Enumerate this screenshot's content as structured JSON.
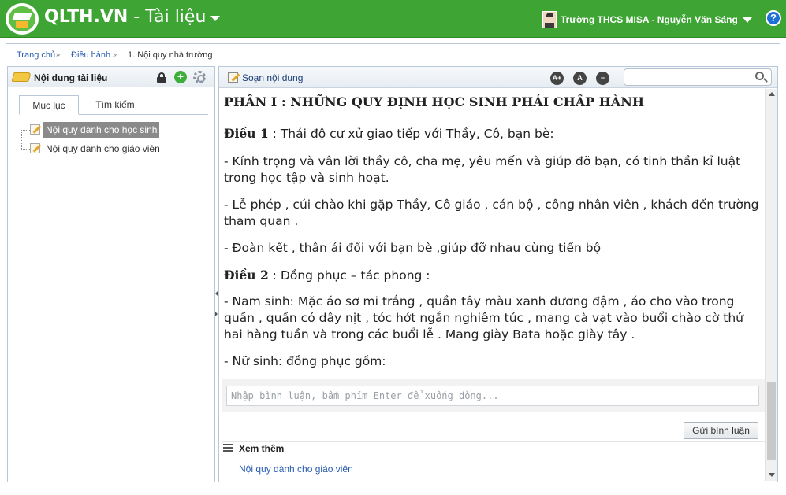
{
  "header": {
    "brand_name": "QLTH.VN",
    "brand_separator": " - ",
    "brand_module": "Tài liệu",
    "user_label": "Trường THCS MISA - Nguyễn Văn Sáng",
    "help_symbol": "?",
    "brand_color": "#3ea535"
  },
  "breadcrumb": {
    "items": [
      "Trang chủ",
      "Điều hành",
      "1. Nội quy nhà trường"
    ],
    "separator": "»"
  },
  "left_panel": {
    "title": "Nội dung tài liệu",
    "add_symbol": "+",
    "tabs": [
      "Mục lục",
      "Tìm kiếm"
    ],
    "tree_items": [
      {
        "label": "Nội quy dành cho học sinh",
        "selected": true
      },
      {
        "label": "Nội quy dành cho giáo viên",
        "selected": false
      }
    ]
  },
  "right_panel": {
    "title": "Soạn nội dung",
    "font_buttons": [
      "A+",
      "A",
      "−"
    ],
    "search_placeholder": "",
    "document": {
      "heading": "PHẦN I : NHỮNG QUY ĐỊNH HỌC SINH PHẢI CHẤP HÀNH",
      "paragraphs": [
        {
          "bold": "Điều 1",
          "text": " : Thái độ cư xử giao tiếp với Thầy, Cô, bạn bè:"
        },
        {
          "bold": "",
          "text": "- Kính trọng và vân lời thầy cô, cha mẹ, yêu mến và giúp đỡ bạn, có tinh thần kỉ luật trong học tập và sinh hoạt."
        },
        {
          "bold": "",
          "text": "- Lễ phép , cúi chào khi gặp Thầy, Cô giáo , cán bộ , công nhân viên , khách đến trường tham quan ."
        },
        {
          "bold": "",
          "text": "- Đoàn kết , thân ái đối với bạn bè ,giúp đỡ nhau cùng tiến bộ"
        },
        {
          "bold": "Điều 2",
          "text": " : Đồng phục – tác phong :"
        },
        {
          "bold": "",
          "text": "- Nam sinh:  Mặc áo sơ mi trắng , quần tây màu xanh dương đậm , áo cho vào trong quần , quần có dây nịt , tóc hớt ngắn nghiêm túc , mang cà vạt vào buổi chào cờ thứ hai hàng tuần và trong các buổi lễ . Mang giày Bata hoặc giày tây ."
        },
        {
          "bold": "",
          "text": "- Nữ sinh: đồng phục gồm:"
        }
      ]
    },
    "comment_placeholder": "Nhập bình luận, bấm phím Enter để xuống dòng...",
    "send_button": "Gửi bình luận",
    "more_title": "Xem thêm",
    "more_links": [
      "Nội quy dành cho giáo viên"
    ]
  }
}
